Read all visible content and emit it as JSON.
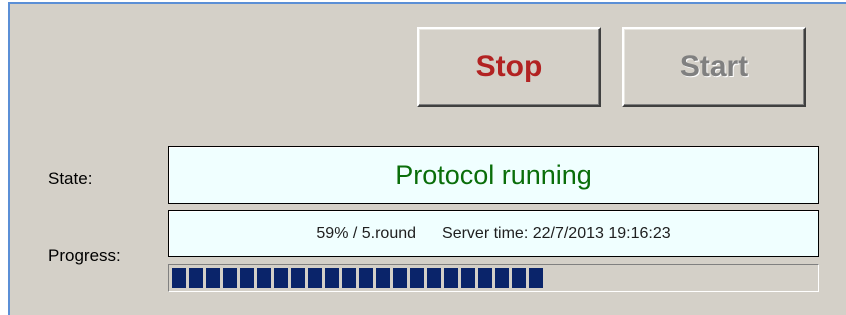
{
  "buttons": {
    "stop_label": "Stop",
    "start_label": "Start"
  },
  "state": {
    "label": "State:",
    "value": "Protocol running",
    "value_color": "#0a6e0a"
  },
  "progress": {
    "label": "Progress:",
    "percent_round_text": "59% / 5.round",
    "server_time_text": "Server time: 22/7/2013 19:16:23",
    "fraction": 0.59,
    "bar_color": "#0a246a"
  },
  "colors": {
    "panel_background": "#d4d0c8",
    "field_background": "#f0ffff",
    "stop_text": "#b22222",
    "start_text_disabled": "#808080",
    "frame_accent": "#5b8fd6"
  }
}
